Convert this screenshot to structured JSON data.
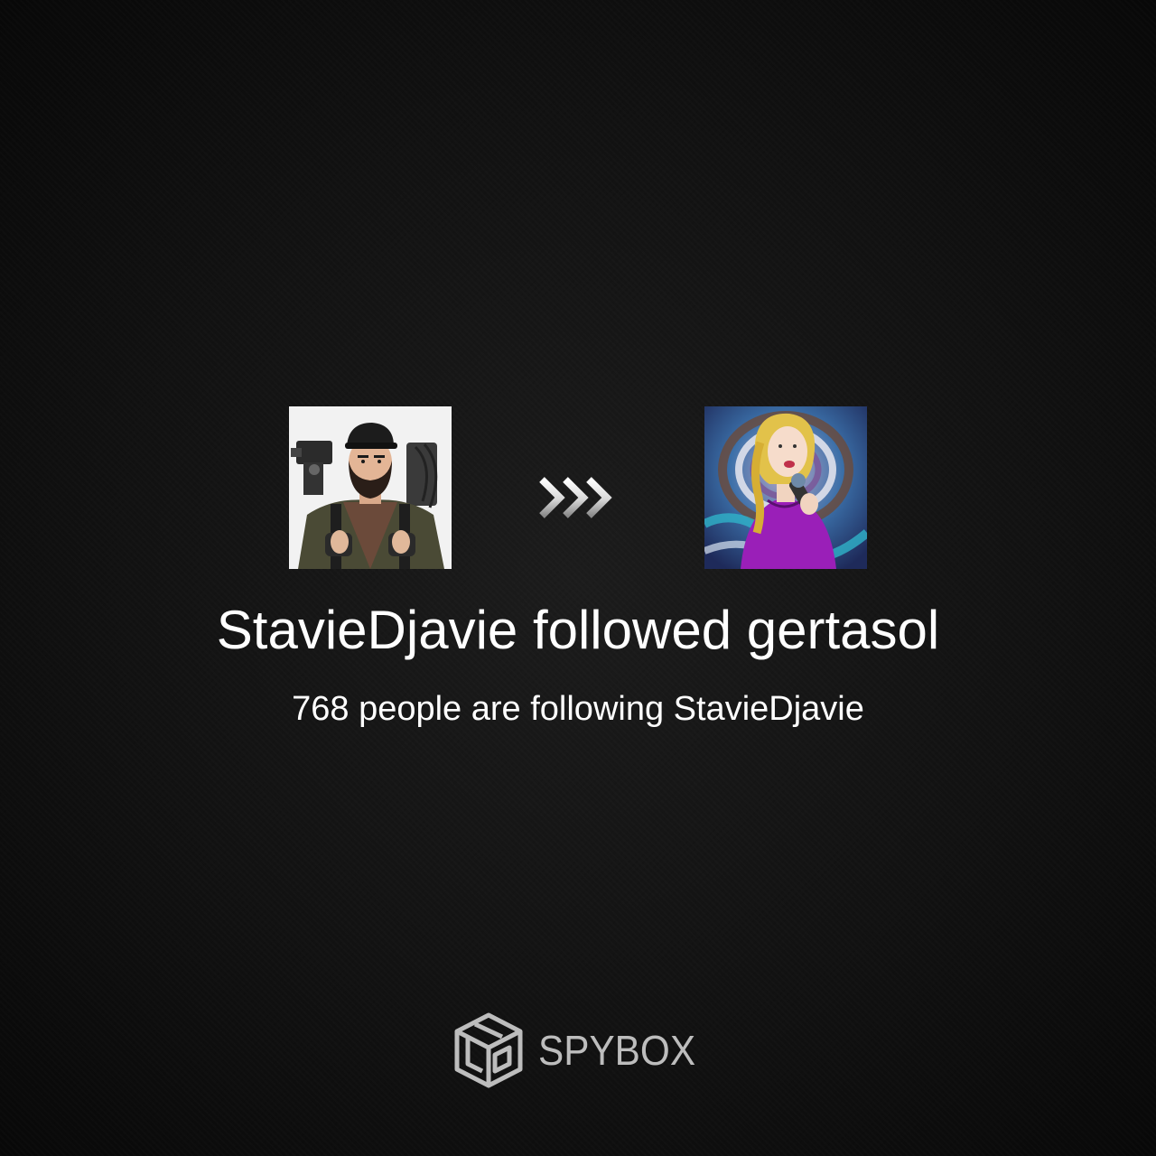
{
  "event": {
    "headline": "StavieDjavie followed gertasol",
    "subline": "768 people are following StavieDjavie"
  },
  "actor": {
    "avatar_icon": "bearded-cameraman-avatar"
  },
  "target": {
    "avatar_icon": "blonde-singer-avatar"
  },
  "connector_icon": "triple-chevron-right-icon",
  "brand": {
    "name": "SPYBOX",
    "logo_icon": "spybox-cube-logo"
  },
  "colors": {
    "background": "#121212",
    "text": "#ffffff",
    "brand_text": "#bdbdbd"
  }
}
